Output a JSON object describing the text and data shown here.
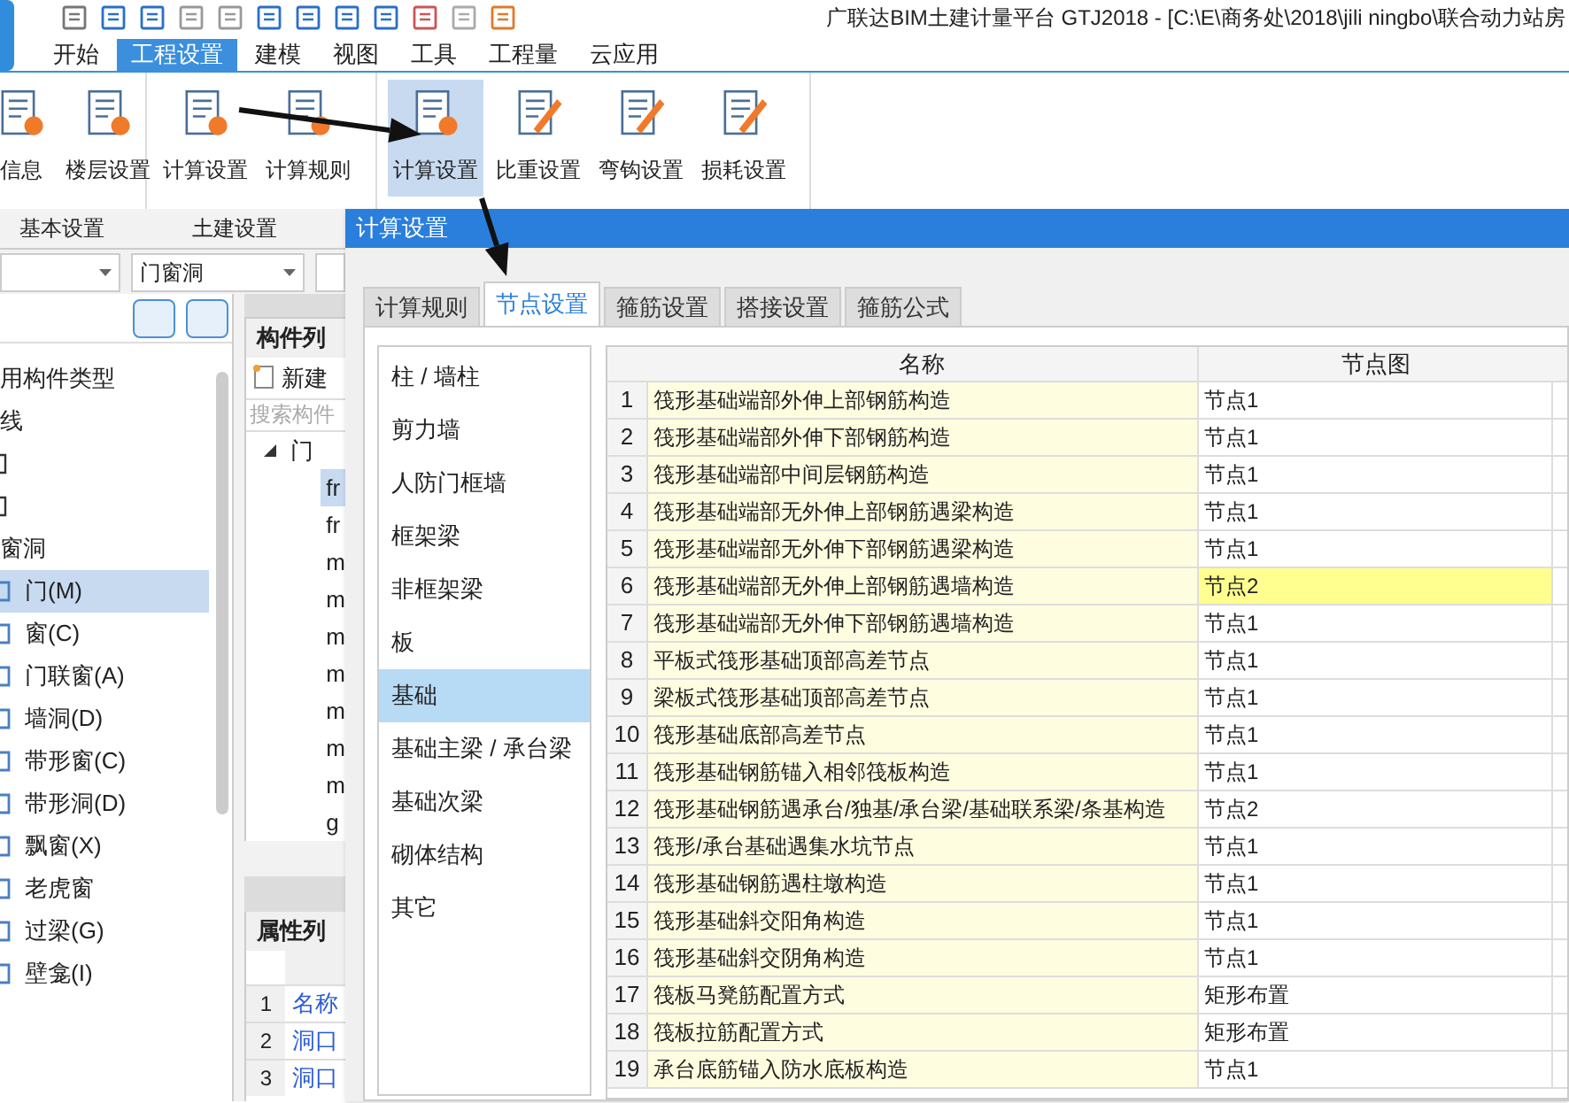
{
  "title_bar": {
    "title": "广联达BIM土建计量平台 GTJ2018 - [C:\\E\\商务处\\2018\\jili ningbo\\联合动力站房"
  },
  "ribbon_tabs": [
    {
      "label": "开始",
      "selected": false
    },
    {
      "label": "工程设置",
      "selected": true
    },
    {
      "label": "建模",
      "selected": false
    },
    {
      "label": "视图",
      "selected": false
    },
    {
      "label": "工具",
      "selected": false
    },
    {
      "label": "工程量",
      "selected": false
    },
    {
      "label": "云应用",
      "selected": false
    }
  ],
  "ribbon_groups": [
    {
      "label": "基本设置",
      "buttons": [
        {
          "label": "信息",
          "selected": false
        },
        {
          "label": "楼层设置",
          "selected": false
        }
      ]
    },
    {
      "label": "土建设置",
      "buttons": [
        {
          "label": "计算设置",
          "selected": false
        },
        {
          "label": "计算规则",
          "selected": false
        }
      ]
    },
    {
      "buttons": [
        {
          "label": "计算设置",
          "selected": true
        },
        {
          "label": "比重设置",
          "selected": false
        },
        {
          "label": "弯钩设置",
          "selected": false
        },
        {
          "label": "损耗设置",
          "selected": false
        }
      ]
    }
  ],
  "filter": {
    "value": "门窗洞"
  },
  "component_tree": {
    "items": [
      {
        "label": "用构件类型"
      },
      {
        "label": "线"
      },
      {
        "kind": "cut"
      },
      {
        "kind": "cut"
      },
      {
        "label": "窗洞",
        "children": [
          {
            "label": "门(M)",
            "selected": true
          },
          {
            "label": "窗(C)",
            "selected": false
          },
          {
            "label": "门联窗(A)",
            "selected": false
          },
          {
            "label": "墙洞(D)",
            "selected": false
          },
          {
            "label": "带形窗(C)",
            "selected": false
          },
          {
            "label": "带形洞(D)",
            "selected": false
          },
          {
            "label": "飘窗(X)",
            "selected": false
          },
          {
            "label": "老虎窗",
            "selected": false
          },
          {
            "label": "过梁(G)",
            "selected": false
          },
          {
            "label": "壁龛(I)",
            "selected": false
          }
        ]
      }
    ]
  },
  "component_list": {
    "title": "构件列",
    "new_button": "新建",
    "search_placeholder": "搜索构件",
    "tree": {
      "label": "门",
      "expanded": true,
      "children": [
        {
          "label": "fr",
          "selected": true
        },
        {
          "label": "fr",
          "selected": false
        },
        {
          "label": "m",
          "selected": false
        },
        {
          "label": "m",
          "selected": false
        },
        {
          "label": "m",
          "selected": false
        },
        {
          "label": "m",
          "selected": false
        },
        {
          "label": "m",
          "selected": false
        },
        {
          "label": "m",
          "selected": false
        },
        {
          "label": "m",
          "selected": false
        },
        {
          "label": "g",
          "selected": false
        }
      ]
    }
  },
  "property_list": {
    "title": "属性列",
    "rows": [
      {
        "index": "1",
        "name": "名称"
      },
      {
        "index": "2",
        "name": "洞口"
      },
      {
        "index": "3",
        "name": "洞口"
      }
    ]
  },
  "dialog": {
    "title": "计算设置",
    "tabs": [
      {
        "label": "计算规则",
        "selected": false
      },
      {
        "label": "节点设置",
        "selected": true
      },
      {
        "label": "箍筋设置",
        "selected": false
      },
      {
        "label": "搭接设置",
        "selected": false
      },
      {
        "label": "箍筋公式",
        "selected": false
      }
    ],
    "categories": [
      {
        "label": "柱 / 墙柱",
        "selected": false
      },
      {
        "label": "剪力墙",
        "selected": false
      },
      {
        "label": "人防门框墙",
        "selected": false
      },
      {
        "label": "框架梁",
        "selected": false
      },
      {
        "label": "非框架梁",
        "selected": false
      },
      {
        "label": "板",
        "selected": false
      },
      {
        "label": "基础",
        "selected": true
      },
      {
        "label": "基础主梁 / 承台梁",
        "selected": false
      },
      {
        "label": "基础次梁",
        "selected": false
      },
      {
        "label": "砌体结构",
        "selected": false
      },
      {
        "label": "其它",
        "selected": false
      }
    ],
    "table": {
      "columns": [
        "名称",
        "节点图"
      ],
      "rows": [
        {
          "index": "1",
          "name": "筏形基础端部外伸上部钢筋构造",
          "node": "节点1",
          "selected": false
        },
        {
          "index": "2",
          "name": "筏形基础端部外伸下部钢筋构造",
          "node": "节点1",
          "selected": false
        },
        {
          "index": "3",
          "name": "筏形基础端部中间层钢筋构造",
          "node": "节点1",
          "selected": false
        },
        {
          "index": "4",
          "name": "筏形基础端部无外伸上部钢筋遇梁构造",
          "node": "节点1",
          "selected": false
        },
        {
          "index": "5",
          "name": "筏形基础端部无外伸下部钢筋遇梁构造",
          "node": "节点1",
          "selected": false
        },
        {
          "index": "6",
          "name": "筏形基础端部无外伸上部钢筋遇墙构造",
          "node": "节点2",
          "selected": true
        },
        {
          "index": "7",
          "name": "筏形基础端部无外伸下部钢筋遇墙构造",
          "node": "节点1",
          "selected": false
        },
        {
          "index": "8",
          "name": "平板式筏形基础顶部高差节点",
          "node": "节点1",
          "selected": false
        },
        {
          "index": "9",
          "name": "梁板式筏形基础顶部高差节点",
          "node": "节点1",
          "selected": false
        },
        {
          "index": "10",
          "name": "筏形基础底部高差节点",
          "node": "节点1",
          "selected": false
        },
        {
          "index": "11",
          "name": "筏形基础钢筋锚入相邻筏板构造",
          "node": "节点1",
          "selected": false
        },
        {
          "index": "12",
          "name": "筏形基础钢筋遇承台/独基/承台梁/基础联系梁/条基构造",
          "node": "节点2",
          "selected": false
        },
        {
          "index": "13",
          "name": "筏形/承台基础遇集水坑节点",
          "node": "节点1",
          "selected": false
        },
        {
          "index": "14",
          "name": "筏形基础钢筋遇柱墩构造",
          "node": "节点1",
          "selected": false
        },
        {
          "index": "15",
          "name": "筏形基础斜交阳角构造",
          "node": "节点1",
          "selected": false
        },
        {
          "index": "16",
          "name": "筏形基础斜交阴角构造",
          "node": "节点1",
          "selected": false
        },
        {
          "index": "17",
          "name": "筏板马凳筋配置方式",
          "node": "矩形布置",
          "selected": false
        },
        {
          "index": "18",
          "name": "筏板拉筋配置方式",
          "node": "矩形布置",
          "selected": false
        },
        {
          "index": "19",
          "name": "承台底筋锚入防水底板构造",
          "node": "节点1",
          "selected": false
        }
      ]
    }
  }
}
